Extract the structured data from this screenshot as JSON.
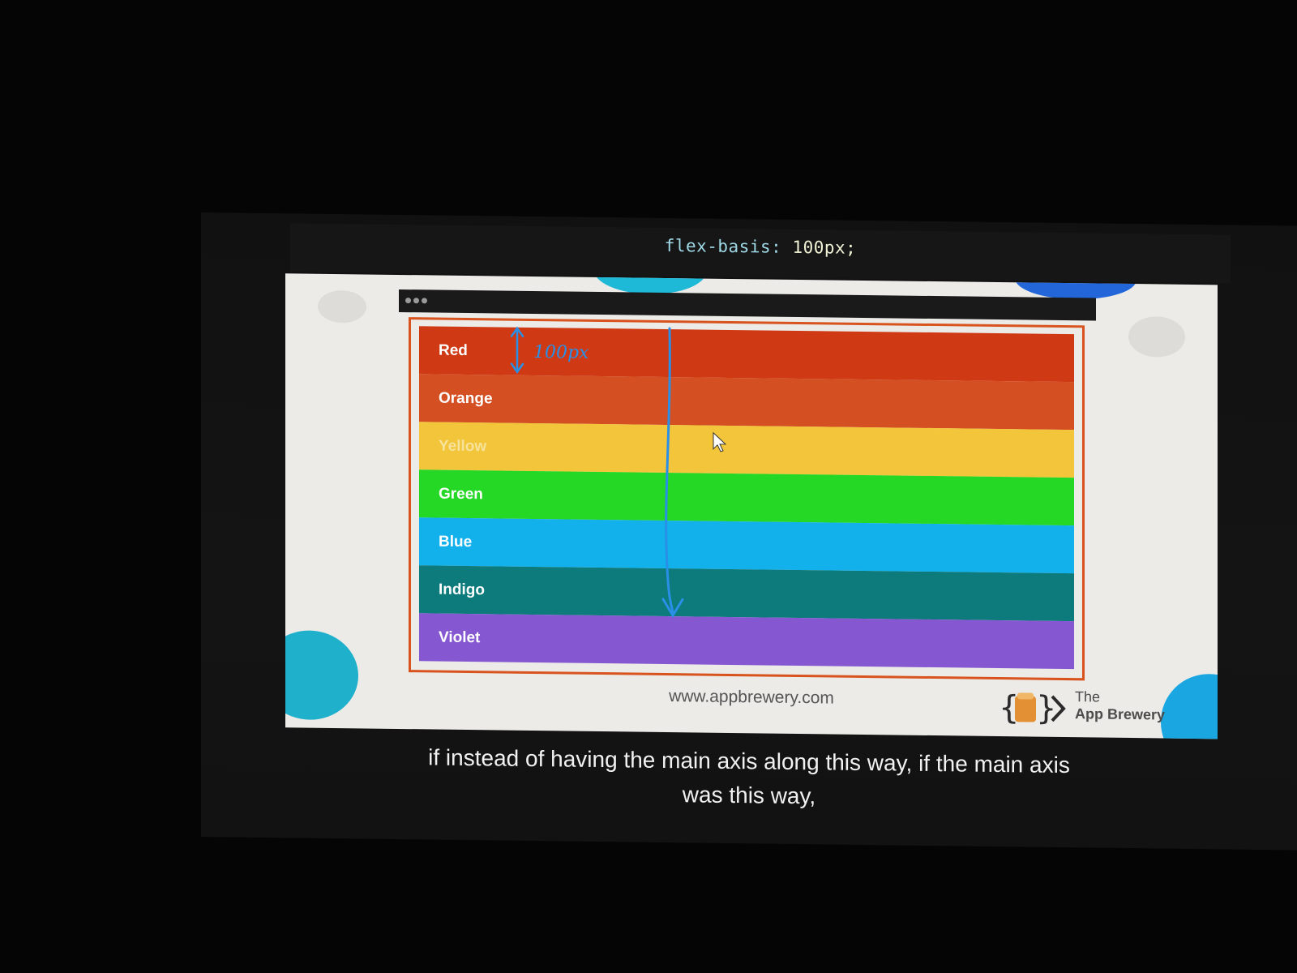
{
  "code": {
    "property": "flex-basis:",
    "value": "100px;"
  },
  "rows": [
    {
      "label": "Red",
      "color": "#cf3a14",
      "text_color": "#ffffff"
    },
    {
      "label": "Orange",
      "color": "#d44f22",
      "text_color": "#ffffff"
    },
    {
      "label": "Yellow",
      "color": "#f2c53a",
      "text_color": "#f6e29a"
    },
    {
      "label": "Green",
      "color": "#25d826",
      "text_color": "#ffffff"
    },
    {
      "label": "Blue",
      "color": "#12b1ec",
      "text_color": "#ffffff"
    },
    {
      "label": "Indigo",
      "color": "#0d7b7b",
      "text_color": "#ffffff"
    },
    {
      "label": "Violet",
      "color": "#8558d2",
      "text_color": "#ffffff"
    }
  ],
  "annotation": {
    "handwritten_text": "100px",
    "ink_color": "#2a8fe6"
  },
  "footer": {
    "url": "www.appbrewery.com",
    "brand_line1": "The",
    "brand_line2": "App Brewery"
  },
  "caption": {
    "line1": "if instead of having the main axis along this way, if the main axis",
    "line2": "was this way,"
  }
}
